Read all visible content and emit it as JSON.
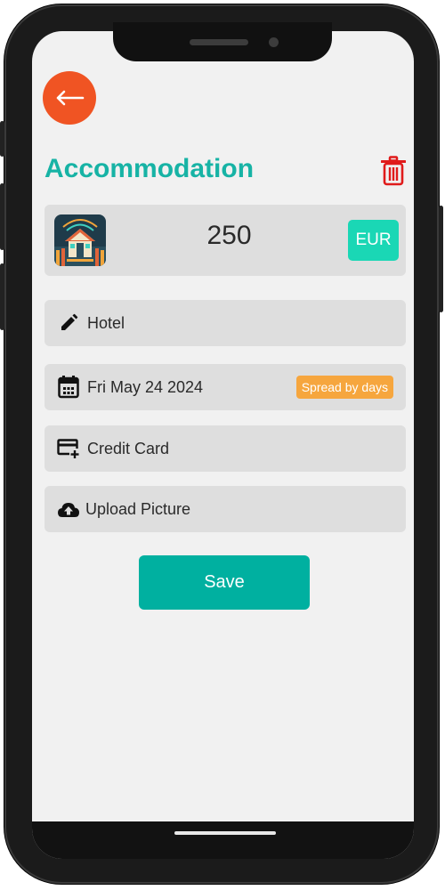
{
  "header": {
    "back_icon": "arrow-left-icon",
    "title": "Accommodation",
    "delete_icon": "trash-icon"
  },
  "amount": {
    "category_icon": "house-icon",
    "value": "250",
    "currency": "EUR"
  },
  "fields": {
    "description": {
      "icon": "pencil-icon",
      "value": "Hotel"
    },
    "date": {
      "icon": "calendar-icon",
      "value": "Fri May 24 2024",
      "spread_label": "Spread by days"
    },
    "payment": {
      "icon": "credit-card-add-icon",
      "value": "Credit Card"
    },
    "upload": {
      "icon": "cloud-upload-icon",
      "value": "Upload Picture"
    }
  },
  "actions": {
    "save_label": "Save"
  },
  "colors": {
    "accent": "#17b3a5",
    "back_button": "#f05423",
    "delete": "#e01b1b",
    "currency_badge": "#1ad7b5",
    "spread_badge": "#f6a63e",
    "save_button": "#00b0a0"
  }
}
